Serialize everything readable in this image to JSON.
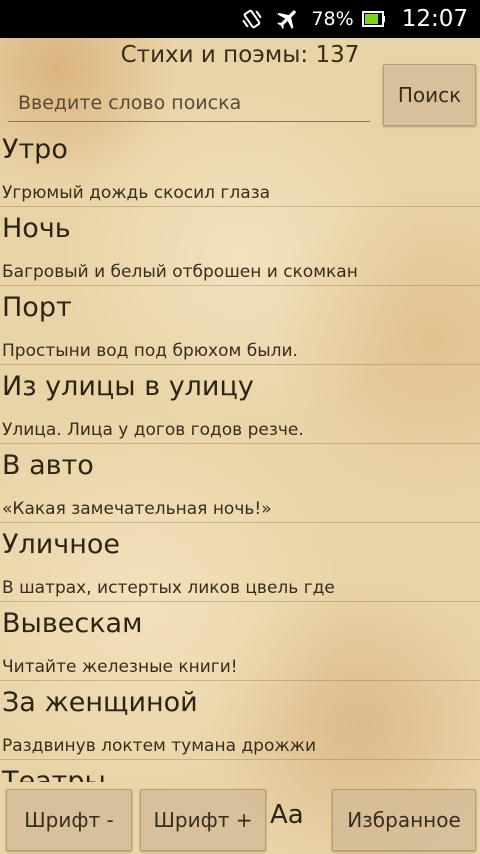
{
  "status_bar": {
    "battery_percent": "78%",
    "time": "12:07",
    "icons": [
      "vibrate-icon",
      "airplane-mode-icon",
      "battery-icon"
    ]
  },
  "header": {
    "count_label": "Стихи и поэмы: 137"
  },
  "search": {
    "placeholder": "Введите слово поиска",
    "button_label": "Поиск"
  },
  "poems": [
    {
      "title": "Утро",
      "first_line": "Угрюмый дождь скосил глаза"
    },
    {
      "title": "Ночь",
      "first_line": "Багровый и белый отброшен и скомкан"
    },
    {
      "title": "Порт",
      "first_line": "Простыни вод под брюхом были."
    },
    {
      "title": "Из улицы в улицу",
      "first_line": "Улица. Лица у догов годов резче."
    },
    {
      "title": "В авто",
      "first_line": "«Какая замечательная ночь!»"
    },
    {
      "title": "Уличное",
      "first_line": "В шатрах, истертых ликов цвель где"
    },
    {
      "title": "Вывескам",
      "first_line": "Читайте железные книги!"
    },
    {
      "title": "За женщиной",
      "first_line": "Раздвинув локтем тумана дрожжи"
    },
    {
      "title": "Театры",
      "first_line": ""
    }
  ],
  "bottom_bar": {
    "font_decrease_label": "Шрифт -",
    "font_increase_label": "Шрифт +",
    "font_sample_label": "Аа",
    "favorites_label": "Избранное"
  }
}
